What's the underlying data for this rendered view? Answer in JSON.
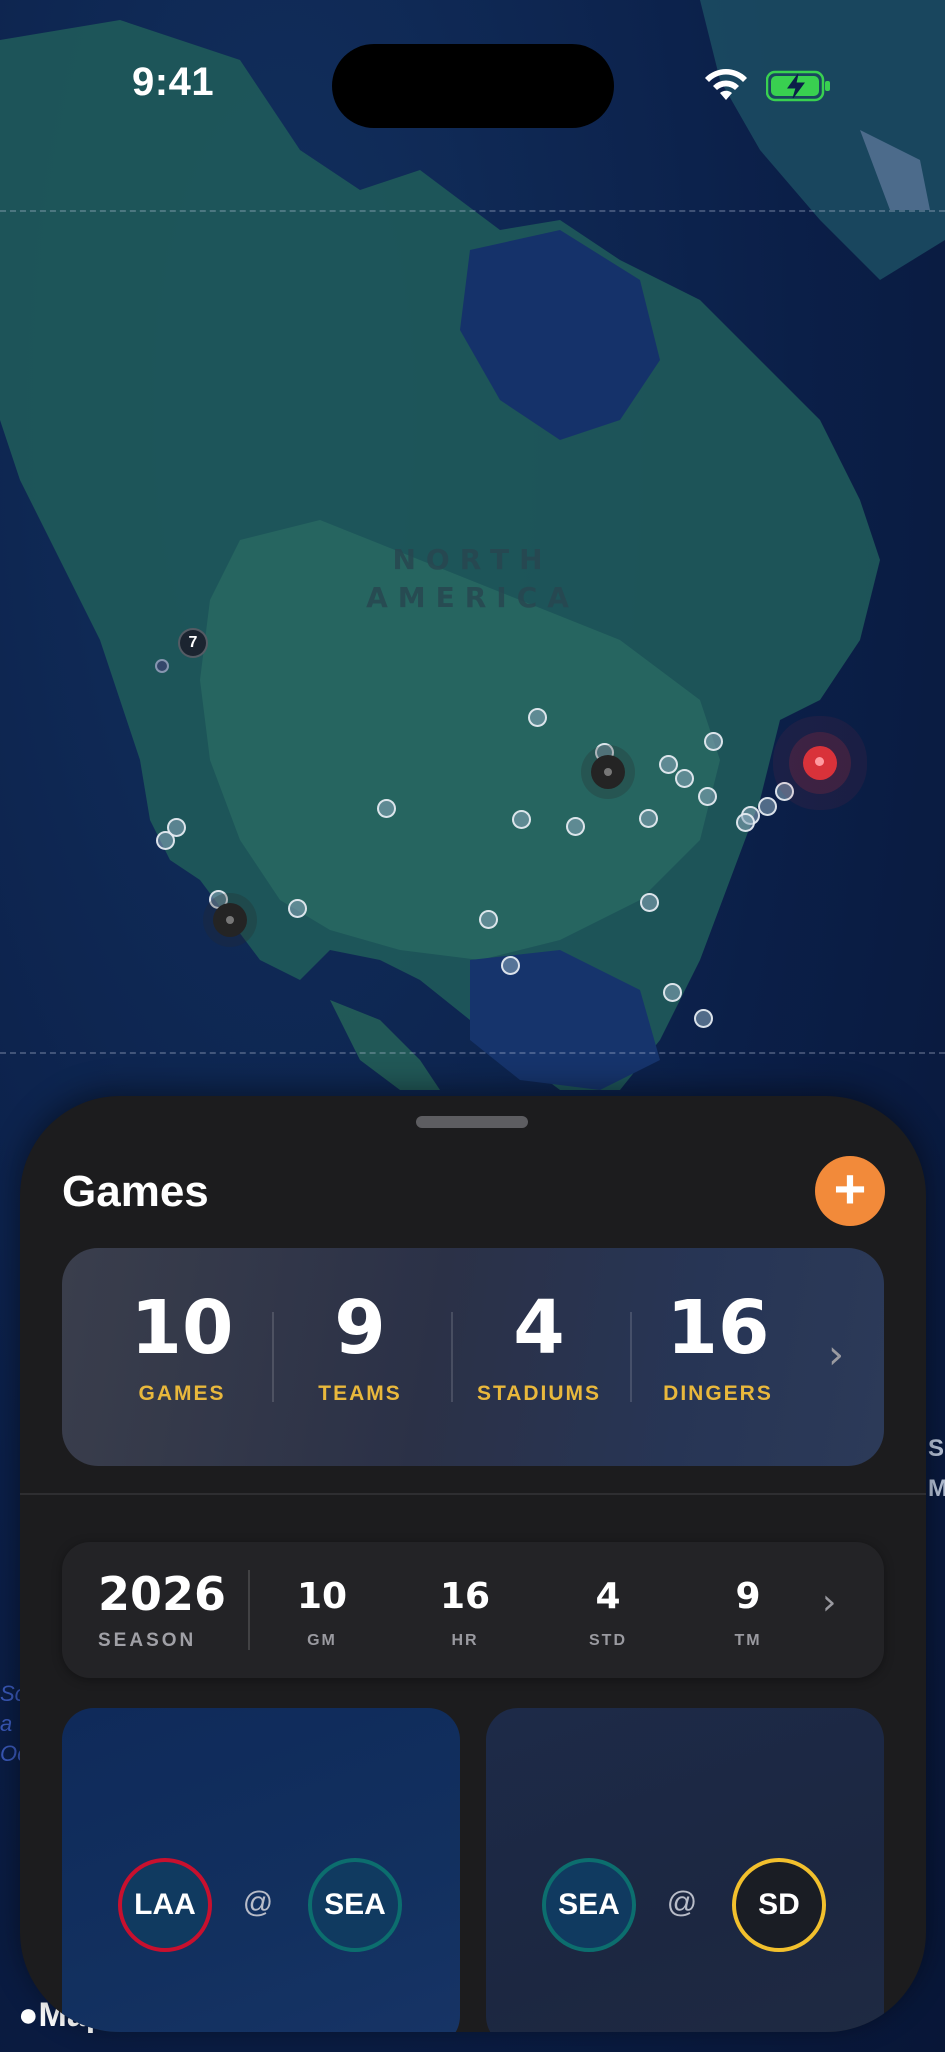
{
  "status_bar": {
    "time": "9:41"
  },
  "map": {
    "continent_label_line1": "NORTH",
    "continent_label_line2": "AMERICA",
    "cluster_count": "7",
    "attribution": "Maps",
    "edge_text_left": [
      "Sc",
      "a",
      "Oc"
    ],
    "edge_text_right": [
      "S",
      "M"
    ]
  },
  "sheet": {
    "title": "Games",
    "add_icon": "plus-icon",
    "stats": [
      {
        "value": "10",
        "label": "GAMES"
      },
      {
        "value": "9",
        "label": "TEAMS"
      },
      {
        "value": "4",
        "label": "STADIUMS"
      },
      {
        "value": "16",
        "label": "DINGERS"
      }
    ],
    "season": {
      "year": "2026",
      "label": "SEASON",
      "stats": [
        {
          "value": "10",
          "label": "GM"
        },
        {
          "value": "16",
          "label": "HR"
        },
        {
          "value": "4",
          "label": "STD"
        },
        {
          "value": "9",
          "label": "TM"
        }
      ]
    },
    "games": [
      {
        "away": "LAA",
        "at": "@",
        "home": "SEA",
        "away_color": "#c8102e",
        "home_color": "#0c6e6e"
      },
      {
        "away": "SEA",
        "at": "@",
        "home": "SD",
        "away_color": "#0c6e6e",
        "home_color": "#f2c02d"
      }
    ]
  },
  "colors": {
    "accent": "#f28a3a",
    "stat_label": "#e9b83c",
    "sheet_bg": "#1c1c1e"
  }
}
